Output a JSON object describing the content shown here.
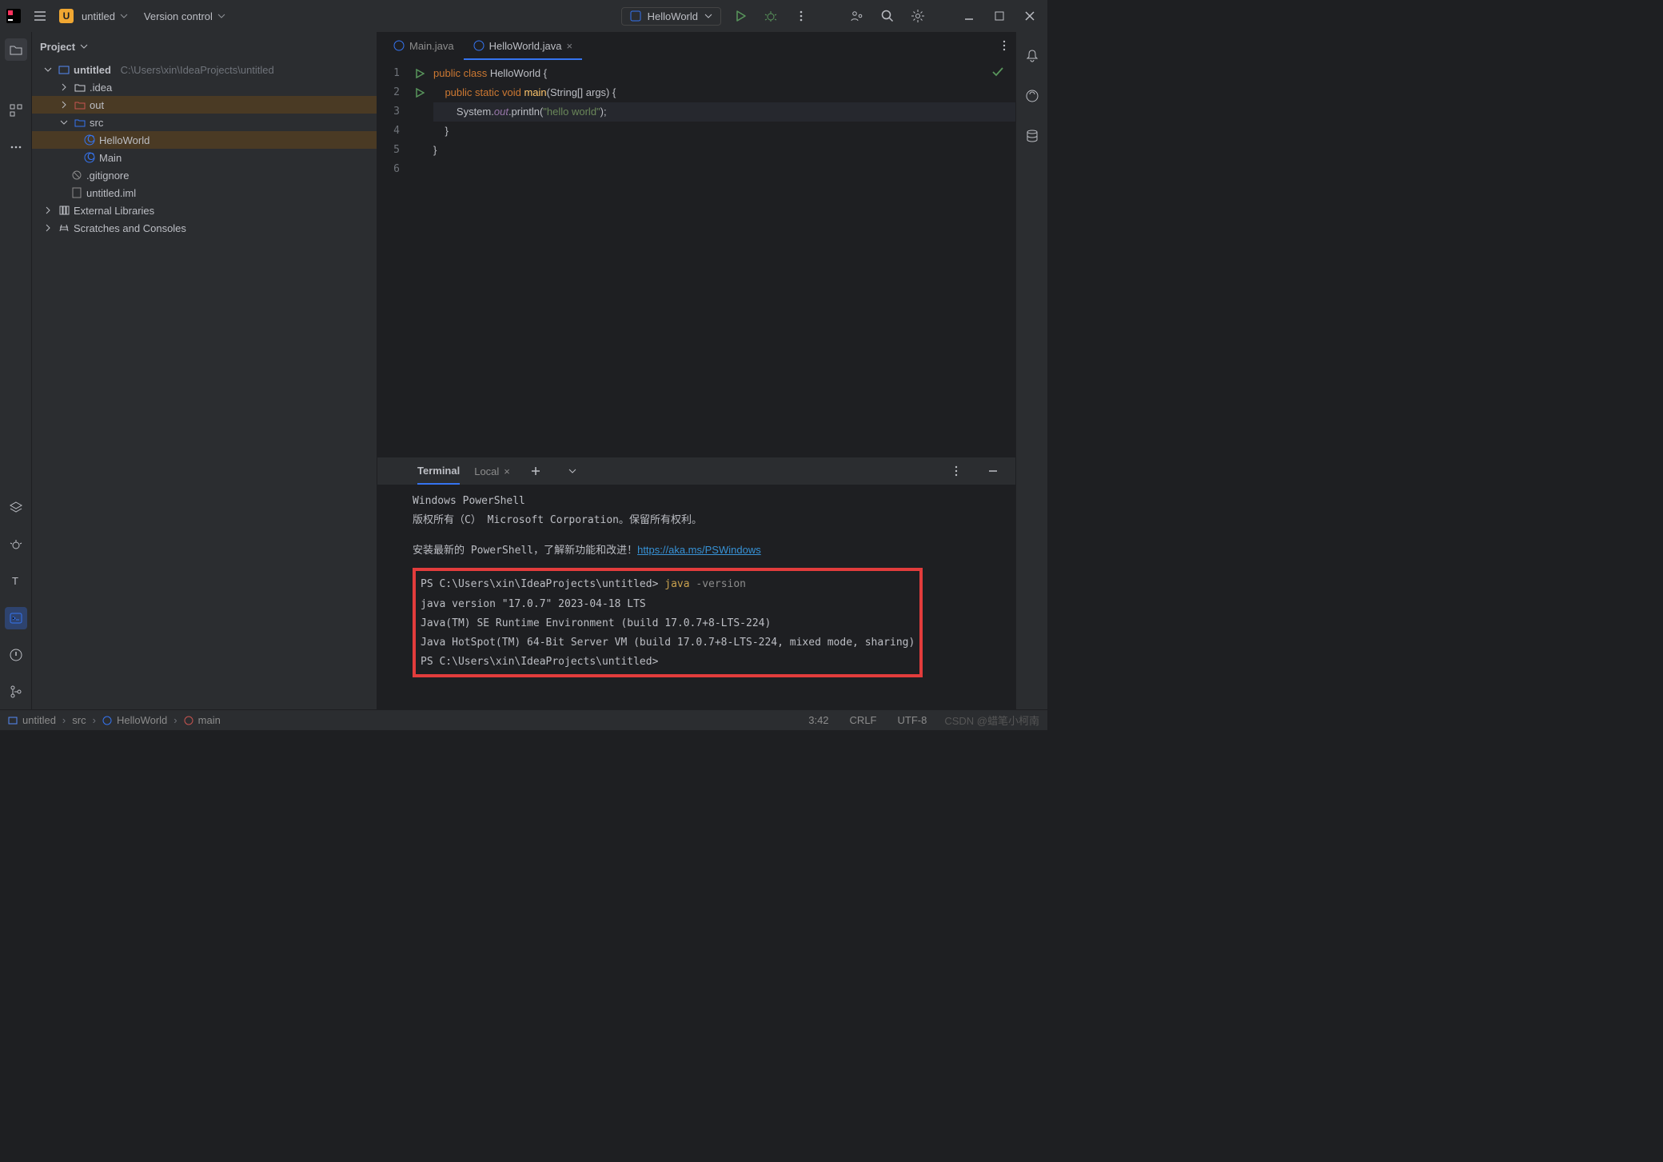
{
  "titlebar": {
    "project_badge": "U",
    "project_name": "untitled",
    "vcs_label": "Version control",
    "run_config": "HelloWorld"
  },
  "project_panel": {
    "title": "Project",
    "root_name": "untitled",
    "root_path": "C:\\Users\\xin\\IdeaProjects\\untitled",
    "nodes": {
      "idea": ".idea",
      "out": "out",
      "src": "src",
      "hello": "HelloWorld",
      "main": "Main",
      "gitignore": ".gitignore",
      "iml": "untitled.iml",
      "ext": "External Libraries",
      "scratch": "Scratches and Consoles"
    }
  },
  "tabs": {
    "main": "Main.java",
    "hello": "HelloWorld.java"
  },
  "editor": {
    "lines": [
      "1",
      "2",
      "3",
      "4",
      "5",
      "6"
    ],
    "l1": {
      "a": "public class ",
      "b": "HelloWorld {"
    },
    "l2": {
      "a": "    public static void ",
      "b": "main",
      "c": "(String[] args) {"
    },
    "l3": {
      "a": "        System.",
      "b": "out",
      "c": ".println(",
      "d": "\"hello world\"",
      "e": ");"
    },
    "l4": "    }",
    "l5": "}",
    "l6": ""
  },
  "terminal": {
    "title": "Terminal",
    "tab": "Local",
    "lines": {
      "l1": "Windows PowerShell",
      "l2": "版权所有（C） Microsoft Corporation。保留所有权利。",
      "l3a": "安装最新的 PowerShell，了解新功能和改进！",
      "l3link": "https://aka.ms/PSWindows",
      "p1": "PS C:\\Users\\xin\\IdeaProjects\\untitled> ",
      "cmd": "java ",
      "arg": "-version",
      "o1": "java version \"17.0.7\" 2023-04-18 LTS",
      "o2": "Java(TM) SE Runtime Environment (build 17.0.7+8-LTS-224)",
      "o3": "Java HotSpot(TM) 64-Bit Server VM (build 17.0.7+8-LTS-224, mixed mode, sharing)",
      "p2": "PS C:\\Users\\xin\\IdeaProjects\\untitled>"
    }
  },
  "status": {
    "crumb1": "untitled",
    "crumb2": "src",
    "crumb3": "HelloWorld",
    "crumb4": "main",
    "pos": "3:42",
    "eol": "CRLF",
    "enc": "UTF-8",
    "watermark": "CSDN @蜡笔小柯南"
  }
}
